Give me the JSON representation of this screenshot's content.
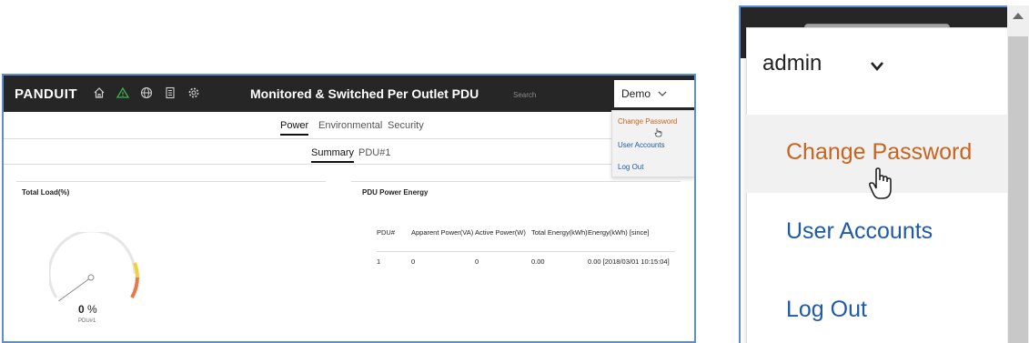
{
  "app": {
    "brand": "PANDUIT",
    "title": "Monitored & Switched Per Outlet PDU",
    "search_placeholder": "Search",
    "user": "Demo",
    "nav_icons": [
      "home-icon",
      "warning-icon",
      "globe-icon",
      "document-icon",
      "gear-icon"
    ],
    "tabs_primary": [
      "Power",
      "Environmental",
      "Security"
    ],
    "tabs_secondary": [
      "Summary",
      "PDU#1"
    ],
    "user_menu": [
      "Change Password",
      "User Accounts",
      "Log Out"
    ],
    "total_load": {
      "title": "Total Load(%)",
      "value": "0",
      "unit": "%",
      "label": "PDU#1",
      "fraction": 0
    },
    "energy": {
      "title": "PDU Power Energy",
      "columns": [
        "PDU#",
        "Apparent Power(VA)",
        "Active Power(W)",
        "Total Energy(kWh)",
        "Energy(kWh) [since]"
      ],
      "rows": [
        [
          "1",
          "0",
          "0",
          "0.00",
          "0.00 [2018/03/01 10:15:04]"
        ]
      ]
    }
  },
  "zoom": {
    "user": "admin",
    "ghost_user": "dmin",
    "menu": [
      "Change Password",
      "User Accounts",
      "Log Out"
    ]
  },
  "colors": {
    "topbar": "#262626",
    "accent_orange": "#c8641e",
    "link_blue": "#1e5aa8",
    "frame_blue": "#5b8fd1",
    "warning_green": "#3cb44b"
  }
}
